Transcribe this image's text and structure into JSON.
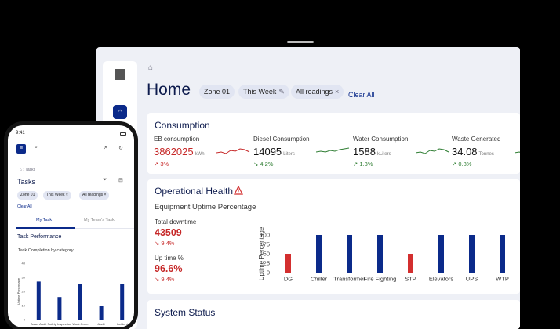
{
  "tablet": {
    "rail": {
      "home_label": "Home"
    },
    "title": "Home",
    "filters": [
      {
        "label": "Zone 01",
        "icon": ""
      },
      {
        "label": "This Week",
        "icon": "edit-icon"
      },
      {
        "label": "All readings",
        "icon": "close-icon"
      }
    ],
    "clear_all": "Clear All",
    "consumption": {
      "title": "Consumption",
      "metrics": [
        {
          "label": "EB consumption",
          "value": "3862025",
          "unit": "kWh",
          "trend": "3%",
          "direction": "up",
          "value_color": "#c62828",
          "spark_color": "#c62828"
        },
        {
          "label": "Diesel Consumption",
          "value": "14095",
          "unit": "Liters",
          "trend": "4.2%",
          "direction": "down",
          "value_color": "#111111",
          "spark_color": "#2e7d32"
        },
        {
          "label": "Water Consumption",
          "value": "1588",
          "unit": "kLiters",
          "trend": "1.3%",
          "direction": "up",
          "value_color": "#111111",
          "spark_color": "#2e7d32"
        },
        {
          "label": "Waste Generated",
          "value": "34.08",
          "unit": "Tonnes",
          "trend": "0.8%",
          "direction": "up",
          "value_color": "#111111",
          "spark_color": "#2e7d32"
        }
      ]
    },
    "operational": {
      "title": "Operational Health",
      "subtitle": "Equipment Uptime Percentage",
      "downtime_label": "Total downtime",
      "downtime_value": "43509",
      "downtime_trend": "9.4%",
      "uptime_label": "Up time %",
      "uptime_value": "96.6%",
      "uptime_trend": "9.4%"
    },
    "system_status": {
      "title": "System Status"
    }
  },
  "chart_data": [
    {
      "type": "bar",
      "title": "",
      "ylabel": "Uptime Percentage",
      "xlabel": "",
      "ylim": [
        0,
        100
      ],
      "yticks": [
        0,
        25,
        50,
        75,
        100
      ],
      "categories": [
        "DG",
        "Chiller",
        "Transformer",
        "Fire Fighting",
        "STP",
        "Elevators",
        "UPS",
        "WTP"
      ],
      "values": [
        50,
        100,
        100,
        100,
        50,
        100,
        100,
        100
      ],
      "colors": [
        "#d32f2f",
        "#0b2a8a",
        "#0b2a8a",
        "#0b2a8a",
        "#d32f2f",
        "#0b2a8a",
        "#0b2a8a",
        "#0b2a8a"
      ],
      "grid": false
    },
    {
      "type": "bar",
      "title": "Task Completion by category",
      "ylabel": "Uptime Percentage",
      "xlabel": "",
      "ylim": [
        0,
        40
      ],
      "yticks": [
        0,
        10,
        20,
        30,
        40
      ],
      "categories": [
        "Asset Audit",
        "Safety Inspection",
        "Work Order",
        "Audit",
        "Incident"
      ],
      "values": [
        27,
        16,
        25,
        10,
        25
      ],
      "colors": [
        "#0b2a8a",
        "#0b2a8a",
        "#0b2a8a",
        "#0b2a8a",
        "#0b2a8a"
      ],
      "grid": false
    }
  ],
  "phone": {
    "time": "9:41",
    "crumb": "Tasks",
    "title": "Tasks",
    "filters": [
      "Zone 01",
      "This Week",
      "All readings"
    ],
    "clear_all": "Clear All",
    "tabs": [
      "My Task",
      "My Team's Task"
    ],
    "section_title": "Task Performance",
    "chart_title": "Task Completion by category"
  }
}
